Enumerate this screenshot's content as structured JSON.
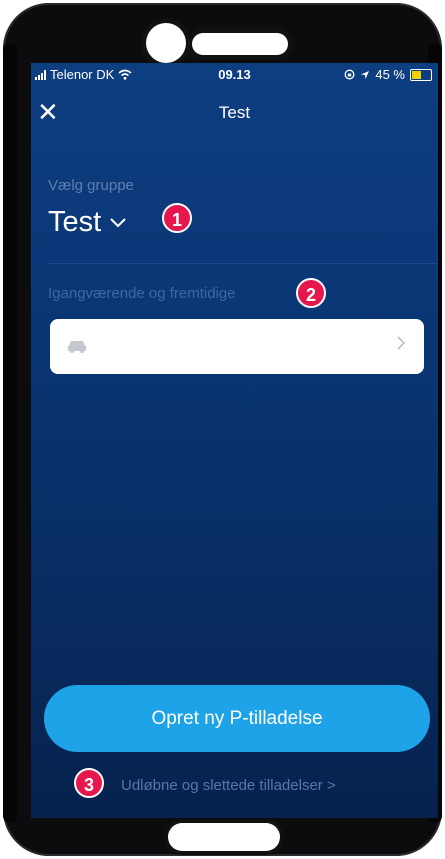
{
  "status_bar": {
    "carrier": "Telenor DK",
    "time": "09.13",
    "battery": "45 %",
    "battery_level": 0.45
  },
  "header": {
    "close_icon": "close-icon",
    "title": "Test"
  },
  "group": {
    "label": "Vælg gruppe",
    "value": "Test",
    "dropdown_icon": "chevron-down-icon"
  },
  "permits": {
    "label": "Igangværende og fremtidige",
    "item_icon": "car-icon",
    "item_arrow": "chevron-right-icon"
  },
  "actions": {
    "create_button": "Opret ny P-tilladelse",
    "expired_link": "Udløbne og slettede tilladelser >"
  },
  "badges": [
    "1",
    "2",
    "3"
  ],
  "colors": {
    "screen_bg": "#0b3a79",
    "primary_button": "#1ea2e8",
    "badge": "#e5174c"
  }
}
